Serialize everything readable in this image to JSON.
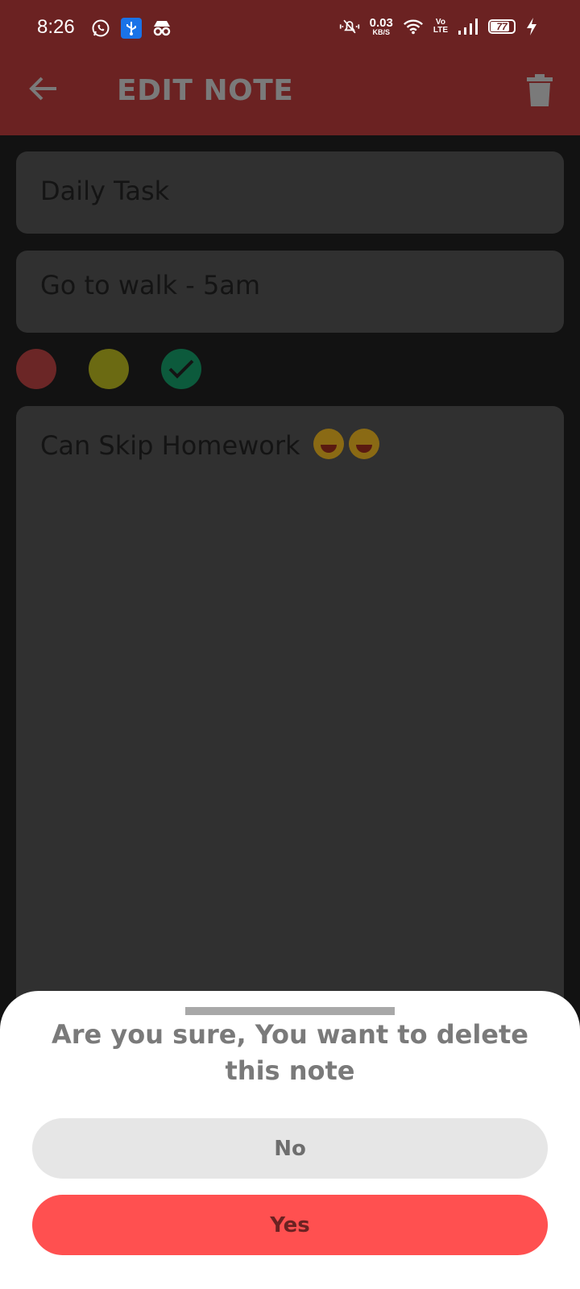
{
  "status_bar": {
    "time": "8:26",
    "net_speed_value": "0.03",
    "net_speed_unit": "KB/S",
    "volte_top": "Vo",
    "volte_bottom": "LTE",
    "battery": "77"
  },
  "app_bar": {
    "title": "EDIT NOTE"
  },
  "note": {
    "title": "Daily Task",
    "subtitle_line1": "Go to walk - 5am",
    "body": "Can Skip Homework"
  },
  "colors": {
    "status_bar_bg": "#6b2222",
    "app_bar_bg": "#6b2222",
    "field_bg": "#303030",
    "note_color_red": "#6b2626",
    "note_color_yellow": "#6b6a12",
    "note_color_green": "#0c5a3c",
    "yes_button": "#ff5050",
    "no_button": "#e6e6e6"
  },
  "color_options": [
    {
      "name": "red",
      "selected": false
    },
    {
      "name": "yellow",
      "selected": false
    },
    {
      "name": "green",
      "selected": true
    }
  ],
  "dialog": {
    "message": "Are you sure, You want to delete this note",
    "no_label": "No",
    "yes_label": "Yes"
  },
  "icons": {
    "back": "arrow-left-icon",
    "delete": "trash-icon",
    "whatsapp": "whatsapp-icon",
    "usb": "usb-icon",
    "incognito": "incognito-icon",
    "mute": "bell-off-icon",
    "wifi": "wifi-icon",
    "signal": "signal-icon",
    "charging": "bolt-icon",
    "check": "check-icon",
    "emoji": "grinning-sweat-emoji"
  }
}
